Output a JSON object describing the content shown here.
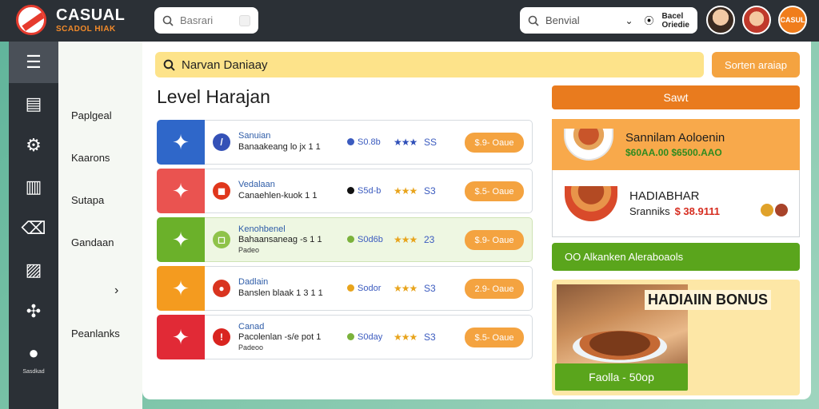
{
  "app": {
    "title": "CASUAL",
    "subtitle": "SCADOL HIAK"
  },
  "top_search": {
    "placeholder": "Basrari"
  },
  "top_search2": {
    "placeholder": "Benvial"
  },
  "location_label": "Bacel\nOriedie",
  "avatars": {
    "third_label": "CASUL"
  },
  "rail": {
    "items": [
      "menu-icon",
      "book-icon",
      "gear-icon",
      "calendar-icon",
      "trash-icon",
      "chart-icon",
      "puzzle-icon",
      "bomb-icon"
    ],
    "bottom_label": "Sasdkad"
  },
  "menu": {
    "items": [
      "Paplgeal",
      "Kaarons",
      "Sutapa",
      "Gandaan",
      "Peanlanks"
    ]
  },
  "banner_search": {
    "text": "Narvan Daniaay"
  },
  "button_sortan": "Sorten araiap",
  "page_title": "Level Harajan",
  "levels": [
    {
      "name": "Sanuian",
      "desc": "Banaakeang lo jx 1 1",
      "desc2": "",
      "score": "S0.8b",
      "stars": "★★★",
      "rating": "SS",
      "price": "$.9- Oaue",
      "icon_color": "#2f67c9",
      "badge_color": "#3451b7",
      "badge": "/",
      "dot": "#3b5bbf",
      "star_color": "#2f4fb8"
    },
    {
      "name": "Vedalaan",
      "desc": "Canaehlen-kuok 1 1",
      "desc2": "",
      "score": "S5d-b",
      "stars": "★★★",
      "rating": "S3",
      "price": "$.5- Oaue",
      "icon_color": "#ea5350",
      "badge_color": "#e0371c",
      "badge": "◼",
      "dot": "#111",
      "star_color": "#e8a41c"
    },
    {
      "name": "Kenohbenel",
      "desc": "Bahaansaneag -s 1 1",
      "desc2": "Padeo",
      "score": "S0d6b",
      "stars": "★★★",
      "rating": "23",
      "price": "$.9- Oaue",
      "icon_color": "#6bb12a",
      "badge_color": "#8fc34a",
      "badge": "◻",
      "dot": "#7bb23c",
      "star_color": "#e8a41c"
    },
    {
      "name": "Dadlain",
      "desc": "Banslen blaak 1 3 1 1",
      "desc2": "",
      "score": "Sodor",
      "stars": "★★★",
      "rating": "S3",
      "price": "2.9- Oaue",
      "icon_color": "#f49b1f",
      "badge_color": "#d9341f",
      "badge": "●",
      "dot": "#e8a41c",
      "star_color": "#e8a41c"
    },
    {
      "name": "Canad",
      "desc": "Pacolenlan -s/e pot 1",
      "desc2": "Padeoo",
      "score": "S0day",
      "stars": "★★★",
      "rating": "S3",
      "price": "$.5- Oaue",
      "icon_color": "#e12a36",
      "badge_color": "#d9241f",
      "badge": "!",
      "dot": "#7bb23c",
      "star_color": "#e8a41c"
    }
  ],
  "right": {
    "top_button": "Sawt",
    "card1": {
      "title": "Sannilam Aoloenin",
      "sub": "$60AA.00 $6500.AAO"
    },
    "card2": {
      "title": "HADIABHAR",
      "sub_label": "Sranniks",
      "price": "$ 38.9111"
    },
    "green_bar": "OO Alkanken Aleraboaols",
    "bonus": {
      "title": "HADIAIIN BONUS",
      "button": "Faolla - 50op"
    }
  }
}
